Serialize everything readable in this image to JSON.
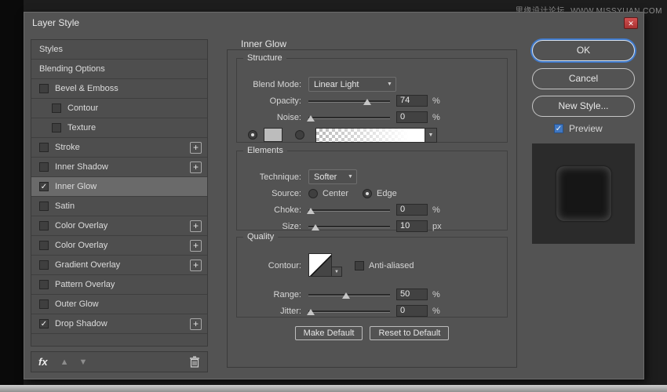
{
  "watermark": {
    "site_name": "思缘设计论坛",
    "site_url": "WWW.MISSYUAN.COM"
  },
  "icons": {
    "close": "✕",
    "check": "✓",
    "dropdown": "▼",
    "up": "▲",
    "down": "▼",
    "plus": "+",
    "fx": "fx"
  },
  "colors": {
    "accent_blue": "#4079c9",
    "close_red": "#c23a3a",
    "glow_swatch_color": "#bcbcbc"
  },
  "dialog": {
    "title": "Layer Style"
  },
  "sidebar": {
    "items": [
      {
        "label": "Styles",
        "checkbox": false,
        "checked": false,
        "selected": false,
        "indent": false,
        "plus": false
      },
      {
        "label": "Blending Options",
        "checkbox": false,
        "checked": false,
        "selected": false,
        "indent": false,
        "plus": false
      },
      {
        "label": "Bevel & Emboss",
        "checkbox": true,
        "checked": false,
        "selected": false,
        "indent": false,
        "plus": false
      },
      {
        "label": "Contour",
        "checkbox": true,
        "checked": false,
        "selected": false,
        "indent": true,
        "plus": false
      },
      {
        "label": "Texture",
        "checkbox": true,
        "checked": false,
        "selected": false,
        "indent": true,
        "plus": false
      },
      {
        "label": "Stroke",
        "checkbox": true,
        "checked": false,
        "selected": false,
        "indent": false,
        "plus": true
      },
      {
        "label": "Inner Shadow",
        "checkbox": true,
        "checked": false,
        "selected": false,
        "indent": false,
        "plus": true
      },
      {
        "label": "Inner Glow",
        "checkbox": true,
        "checked": true,
        "selected": true,
        "indent": false,
        "plus": false
      },
      {
        "label": "Satin",
        "checkbox": true,
        "checked": false,
        "selected": false,
        "indent": false,
        "plus": false
      },
      {
        "label": "Color Overlay",
        "checkbox": true,
        "checked": false,
        "selected": false,
        "indent": false,
        "plus": true
      },
      {
        "label": "Color Overlay",
        "checkbox": true,
        "checked": false,
        "selected": false,
        "indent": false,
        "plus": true
      },
      {
        "label": "Gradient Overlay",
        "checkbox": true,
        "checked": false,
        "selected": false,
        "indent": false,
        "plus": true
      },
      {
        "label": "Pattern Overlay",
        "checkbox": true,
        "checked": false,
        "selected": false,
        "indent": false,
        "plus": false
      },
      {
        "label": "Outer Glow",
        "checkbox": true,
        "checked": false,
        "selected": false,
        "indent": false,
        "plus": false
      },
      {
        "label": "Drop Shadow",
        "checkbox": true,
        "checked": true,
        "selected": false,
        "indent": false,
        "plus": true
      }
    ]
  },
  "panel": {
    "title": "Inner Glow",
    "structure": {
      "legend": "Structure",
      "blend_mode": {
        "label": "Blend Mode:",
        "value": "Linear Light"
      },
      "opacity": {
        "label": "Opacity:",
        "value": "74",
        "unit": "%",
        "pct": 72
      },
      "noise": {
        "label": "Noise:",
        "value": "0",
        "unit": "%",
        "pct": 3
      },
      "glow_color": {
        "solid_selected": true,
        "gradient_selected": false,
        "swatch_color": "#bcbcbc"
      }
    },
    "elements": {
      "legend": "Elements",
      "technique": {
        "label": "Technique:",
        "value": "Softer"
      },
      "source": {
        "label": "Source:",
        "options": [
          {
            "label": "Center",
            "selected": false
          },
          {
            "label": "Edge",
            "selected": true
          }
        ]
      },
      "choke": {
        "label": "Choke:",
        "value": "0",
        "unit": "%",
        "pct": 3
      },
      "size": {
        "label": "Size:",
        "value": "10",
        "unit": "px",
        "pct": 9
      }
    },
    "quality": {
      "legend": "Quality",
      "contour": {
        "label": "Contour:"
      },
      "antialiased": {
        "label": "Anti-aliased",
        "checked": false
      },
      "range": {
        "label": "Range:",
        "value": "50",
        "unit": "%",
        "pct": 46
      },
      "jitter": {
        "label": "Jitter:",
        "value": "0",
        "unit": "%",
        "pct": 3
      }
    },
    "footer": {
      "make_default": "Make Default",
      "reset_default": "Reset to Default"
    }
  },
  "actions": {
    "ok": "OK",
    "cancel": "Cancel",
    "new_style": "New Style...",
    "preview": "Preview",
    "preview_checked": true
  }
}
